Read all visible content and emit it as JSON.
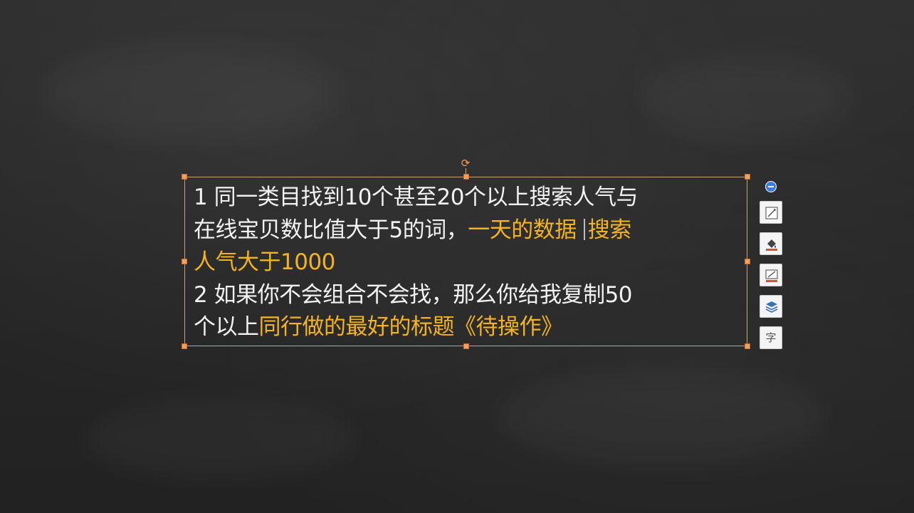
{
  "slide": {
    "lines": [
      [
        {
          "text": "1 同一类目找到10个甚至20个以上搜索人气与",
          "highlight": false
        }
      ],
      [
        {
          "text": "在线宝贝数比值大于5的词，",
          "highlight": false
        },
        {
          "text": "一天的数据",
          "highlight": true
        },
        {
          "text": "搜索",
          "highlight": true,
          "caret_before": true
        }
      ],
      [
        {
          "text": "人气大于1000",
          "highlight": true
        }
      ],
      [
        {
          "text": "2 如果你不会组合不会找，那么你给我复制50",
          "highlight": false
        }
      ],
      [
        {
          "text": "个以上",
          "highlight": false
        },
        {
          "text": "同行做的最好的标题《待操作》",
          "highlight": true
        }
      ]
    ],
    "colors": {
      "text": "#f2f2f2",
      "highlight": "#f4b323",
      "selection_handle": "#f0a060",
      "background": "#2a2a2a"
    }
  },
  "toolbar": {
    "items": [
      {
        "name": "collapse-icon"
      },
      {
        "name": "shape-style-icon"
      },
      {
        "name": "fill-color-icon"
      },
      {
        "name": "outline-icon"
      },
      {
        "name": "layers-icon"
      },
      {
        "name": "text-format-icon",
        "label": "字"
      }
    ]
  },
  "selection": {
    "rotate_glyph": "⟳"
  }
}
